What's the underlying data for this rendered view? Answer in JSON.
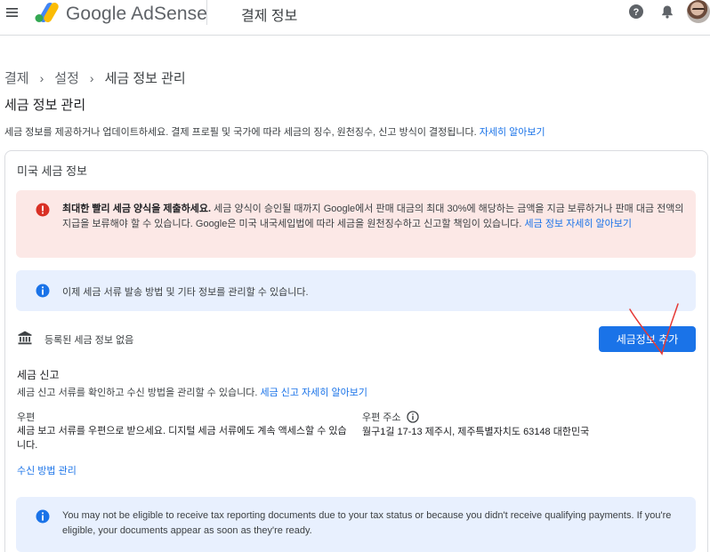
{
  "topbar": {
    "brand": "Google AdSense",
    "page_title": "결제 정보",
    "icons": [
      "menu-icon",
      "adsense-logo",
      "help-icon",
      "bell-icon",
      "avatar"
    ]
  },
  "breadcrumb": {
    "items": [
      "결제",
      "설정",
      "세금 정보 관리"
    ]
  },
  "page": {
    "heading": "세금 정보 관리",
    "description": "세금 정보를 제공하거나 업데이트하세요. 결제 프로필 및 국가에 따라 세금의 징수, 원천징수, 신고 방식이 결정됩니다.",
    "description_link": "자세히 알아보기"
  },
  "card": {
    "title": "미국 세금 정보",
    "error_alert": {
      "bold": "최대한 빨리 세금 양식을 제출하세요.",
      "text": " 세금 양식이 승인될 때까지 Google에서 판매 대금의 최대 30%에 해당하는 금액을 지금 보류하거나 판매 대금 전액의 지급을 보류해야 할 수 있습니다. Google은 미국 내국세입법에 따라 세금을 원천징수하고 신고할 책임이 있습니다. ",
      "link": "세금 정보 자세히 알아보기"
    },
    "info_alert": "이제 세금 서류 발송 방법 및 기타 정보를 관리할 수 있습니다.",
    "no_tax_info": "등록된 세금 정보 없음",
    "add_button": "세금정보 추가",
    "tax_reporting": {
      "title": "세금 신고",
      "description": "세금 신고 서류를 확인하고 수신 방법을 관리할 수 있습니다. ",
      "link": "세금 신고 자세히 알아보기"
    },
    "mail": {
      "label": "우편",
      "description": "세금 보고 서류를 우편으로 받으세요. 디지털 세금 서류에도 계속 액세스할 수 있습니다."
    },
    "address": {
      "label": "우편 주소",
      "value": "월구1길 17-13 제주시, 제주특별자치도 63148 대한민국"
    },
    "manage_link": "수신 방법 관리",
    "notice": "You may not be eligible to receive tax reporting documents due to your tax status or because you didn't receive qualifying payments. If you're eligible, your documents appear as soon as they're ready."
  },
  "colors": {
    "accent": "#1a73e8",
    "error_bg": "#fce8e6",
    "error_icon": "#d93025",
    "info_bg": "#e8f0fe",
    "annotation": "#e53935"
  }
}
